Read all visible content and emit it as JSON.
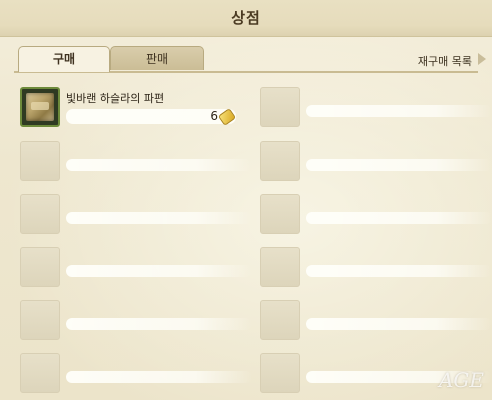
{
  "window": {
    "title": "상점"
  },
  "tabs": [
    {
      "label": "구매",
      "active": true
    },
    {
      "label": "판매",
      "active": false
    }
  ],
  "rebuy_label": "재구매 목록",
  "items": [
    {
      "name": "빛바랜 하슬라의 파편",
      "price": "6",
      "icon": "scroll-fragment-icon"
    },
    null,
    null,
    null,
    null,
    null,
    null,
    null,
    null,
    null,
    null,
    null
  ],
  "watermark": "AGE"
}
